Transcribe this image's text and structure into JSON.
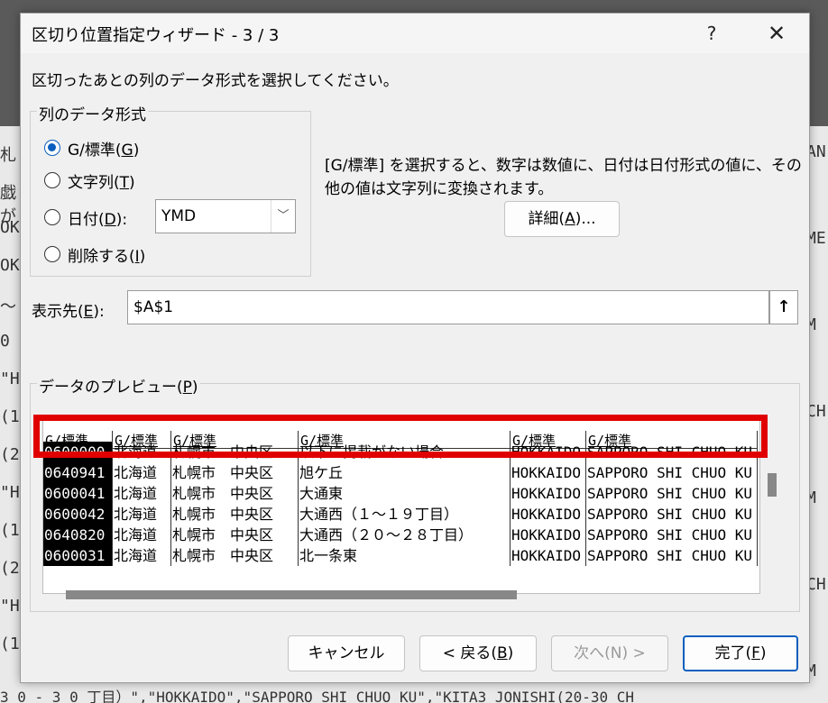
{
  "dialog": {
    "title": "区切り位置指定ウィザード - 3 / 3",
    "help_label": "?",
    "close_label": "✕",
    "instruction": "区切ったあとの列のデータ形式を選択してください。"
  },
  "column_format": {
    "group_label": "列のデータ形式",
    "options": [
      {
        "label_main": "G/標準(",
        "key": "G",
        "label_end": ")",
        "checked": true
      },
      {
        "label_main": "文字列(",
        "key": "T",
        "label_end": ")",
        "checked": false
      },
      {
        "label_main": "日付(",
        "key": "D",
        "label_end": "):",
        "checked": false
      },
      {
        "label_main": "削除する(",
        "key": "I",
        "label_end": ")",
        "checked": false
      }
    ],
    "date_format": "YMD"
  },
  "description": "[G/標準] を選択すると、数字は数値に、日付は日付形式の値に、その他の値は文字列に変換されます。",
  "advanced_button": {
    "main": "詳細(",
    "key": "A",
    "end": ")..."
  },
  "destination": {
    "label_main": "表示先(",
    "key": "E",
    "label_end": "):",
    "value": "$A$1",
    "collapse_icon": "↑"
  },
  "preview": {
    "label_main": "データのプレビュー(",
    "key": "P",
    "label_end": ")",
    "headers": [
      "G/標準",
      "G/標準",
      "G/標準",
      "G/標準",
      "G/標準",
      "G/標準"
    ],
    "rows": [
      [
        "0600000",
        "北海道",
        "札幌市　中央区",
        "以下に掲載がない場合",
        "HOKKAIDO",
        "SAPPORO SHI CHUO KU"
      ],
      [
        "0640941",
        "北海道",
        "札幌市　中央区",
        "旭ケ丘",
        "HOKKAIDO",
        "SAPPORO SHI CHUO KU"
      ],
      [
        "0600041",
        "北海道",
        "札幌市　中央区",
        "大通東",
        "HOKKAIDO",
        "SAPPORO SHI CHUO KU"
      ],
      [
        "0600042",
        "北海道",
        "札幌市　中央区",
        "大通西（１～１９丁目）",
        "HOKKAIDO",
        "SAPPORO SHI CHUO KU"
      ],
      [
        "0640820",
        "北海道",
        "札幌市　中央区",
        "大通西（２０～２８丁目）",
        "HOKKAIDO",
        "SAPPORO SHI CHUO KU"
      ],
      [
        "0600031",
        "北海道",
        "札幌市　中央区",
        "北一条東",
        "HOKKAIDO",
        "SAPPORO SHI CHUO KU"
      ]
    ]
  },
  "buttons": {
    "cancel": "キャンセル",
    "back_main": "< 戻る(",
    "back_key": "B",
    "back_end": ")",
    "next": "次へ(N) >",
    "finish_main": "完了(",
    "finish_key": "F",
    "finish_end": ")"
  },
  "background": {
    "left_fragments": [
      "札",
      "戯が",
      "OK",
      "OK",
      "～",
      "0",
      "\"H",
      "(1",
      "(2",
      "\"H",
      "(1",
      "(2",
      "\"H",
      "(1"
    ],
    "right_fragments": [
      "AN",
      "ME",
      "M",
      "CH",
      "M",
      "CH",
      "M"
    ],
    "bottom_text": "3 0 - 3 0 丁目）\",\"HOKKAIDO\",\"SAPPORO SHI CHUO KU\",\"KITA3 JONISHI(20-30 CH"
  },
  "colors": {
    "accent": "#0a5fbf",
    "highlight": "#e00000"
  }
}
